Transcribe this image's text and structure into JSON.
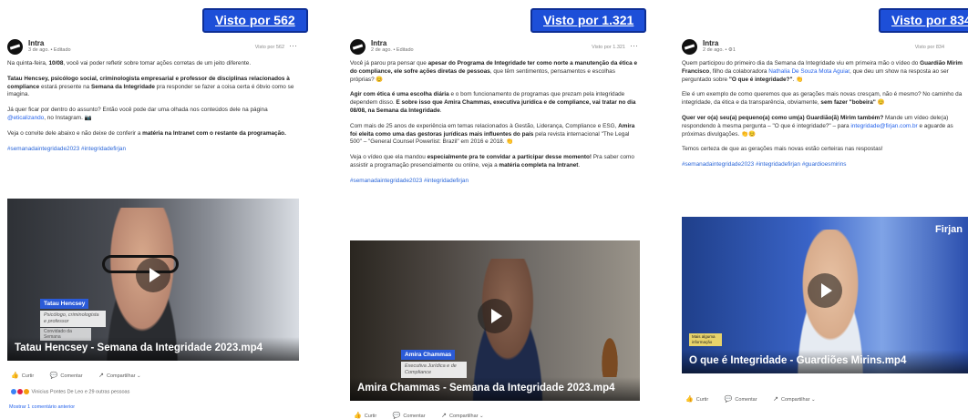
{
  "posts": [
    {
      "views_badge": "Visto por 562",
      "author": "Intra",
      "meta": "3 de ago. • Editado",
      "views_small": "Visto por 562",
      "paragraphs": [
        {
          "before": "Na quinta-feira, ",
          "bold": "10/08",
          "after": ", você vai poder refletir sobre tomar ações corretas de um jeito diferente."
        },
        {
          "bold_all": "Tatau Hencsey, psicólogo social, criminologista empresarial e professor de disciplinas relacionados à compliance",
          "middle": " estará presente na ",
          "bold2": "Semana da Integridade",
          "after": " pra responder se fazer a coisa certa é óbvio como se imagina."
        },
        {
          "before": "Já quer ficar por dentro do assunto? Então você pode dar uma olhada nos conteúdos dele na página ",
          "link": "@eticalizando",
          "after": ", no Instagram. 📷"
        },
        {
          "before": "Veja o convite dele abaixo e não deixe de conferir a ",
          "link": "matéria na Intranet",
          "after": " com o restante da programação."
        }
      ],
      "hashtags": "#semanadaintegridade2023 #integridadefirjan",
      "video": {
        "name_tag": "Tatau Hencsey",
        "role_1": "Psicólogo, criminologista e professor",
        "role_2": "Convidado da Semana",
        "title": "Tatau Hencsey - Semana da Integridade 2023.mp4"
      },
      "actions": [
        "Curtir",
        "Comentar",
        "Compartilhar"
      ],
      "reactions_text": "Vinicius Pontes De Leo e 29 outras pessoas",
      "comments_link": "Mostrar 1 comentário anterior"
    },
    {
      "views_badge": "Visto por 1.321",
      "author": "Intra",
      "meta": "2 de ago. • Editado",
      "views_small": "Visto por 1.321",
      "paragraphs": [
        {
          "before": "Você já parou pra pensar que ",
          "bold": "apesar do Programa de Integridade ter como norte a manutenção da ética e do compliance, ele sofre ações diretas de pessoas",
          "after": ", que têm sentimentos, pensamentos e escolhas próprias? 😊"
        },
        {
          "bold_all": "Agir com ética é uma escolha diária",
          "middle": " e o bom funcionamento de programas que prezam pela integridade dependem disso. ",
          "bold2": "E sobre isso que Amira Chammas, executiva jurídica e de compliance, vai tratar no dia 08/08, na ",
          "link": "Semana da Integridade",
          "after": "."
        },
        {
          "before": "Com mais de 25 anos de experiência em temas relacionados à Gestão, Liderança, Compliance e ESG, ",
          "bold": "Amira foi eleita como uma das gestoras jurídicas mais influentes do país",
          "after": " pela revista internacional \"The Legal 500\" – \"General Counsel Powerlist: Brazil\" em 2016 e 2018. 👏"
        },
        {
          "before": "Veja o vídeo que ela mandou ",
          "bold": "especialmente pra te convidar a participar desse momento!",
          "after": " Pra saber como assistir a programação presencialmente ou online, veja a ",
          "link": "matéria completa na Intranet",
          "after2": "."
        }
      ],
      "hashtags": "#semanadaintegridade2023 #integridadefirjan",
      "video": {
        "name_tag": "Amira Chammas",
        "role_1": "Executiva Jurídica e de Compliance",
        "title": "Amira Chammas - Semana da Integridade 2023.mp4"
      },
      "actions": [
        "Curtir",
        "Comentar",
        "Compartilhar"
      ]
    },
    {
      "views_badge": "Visto por 834",
      "author": "Intra",
      "meta": "2 de ago. • ⚙1",
      "views_small": "Visto por 834",
      "paragraphs": [
        {
          "before": "Quem participou do primeiro dia da Semana da Integridade viu em primeira mão o vídeo do ",
          "bold": "Guardião Mirim Francisco",
          "after": ", filho da colaboradora ",
          "link": "Nathalia De Souza Mota Aguiar",
          "after2": ", que deu um show na resposta ao ser perguntado sobre ",
          "bold3": "\"O que é integridade?\"",
          "after3": ". 👏"
        },
        {
          "before": "Ele é um exemplo de como queremos que as gerações mais novas cresçam, não é mesmo? No caminho da integridade, da ética e da transparência, obviamente, ",
          "bold": "sem fazer \"bobeira\"",
          "after": " 😊"
        },
        {
          "bold_all": "Quer ver o(a) seu(a) pequeno(a) como um(a) Guardião(ã) Mirim também?",
          "middle": " Mande um vídeo dele(a) respondendo à mesma pergunta – \"O que é integridade?\" – para ",
          "link": "integridade@firjan.com.br",
          "after": " e aguarde as próximas divulgações. 👏😊"
        },
        {
          "before": "Temos certeza de que as gerações mais novas estão certeiras nas respostas!"
        }
      ],
      "hashtags": "#semanadaintegridade2023 #integridadefirjan #guardioesmirins",
      "video": {
        "logo": "Firjan",
        "mini_tag": "Mais alguma informação",
        "title": "O que é Integridade - Guardiões Mirins.mp4"
      },
      "actions": [
        "Curtir",
        "Comentar",
        "Compartilhar"
      ]
    }
  ],
  "colors": {
    "badge_blue": "#1d4fd8",
    "link_blue": "#2563eb",
    "name_tag_blue": "#2b5bd8"
  }
}
